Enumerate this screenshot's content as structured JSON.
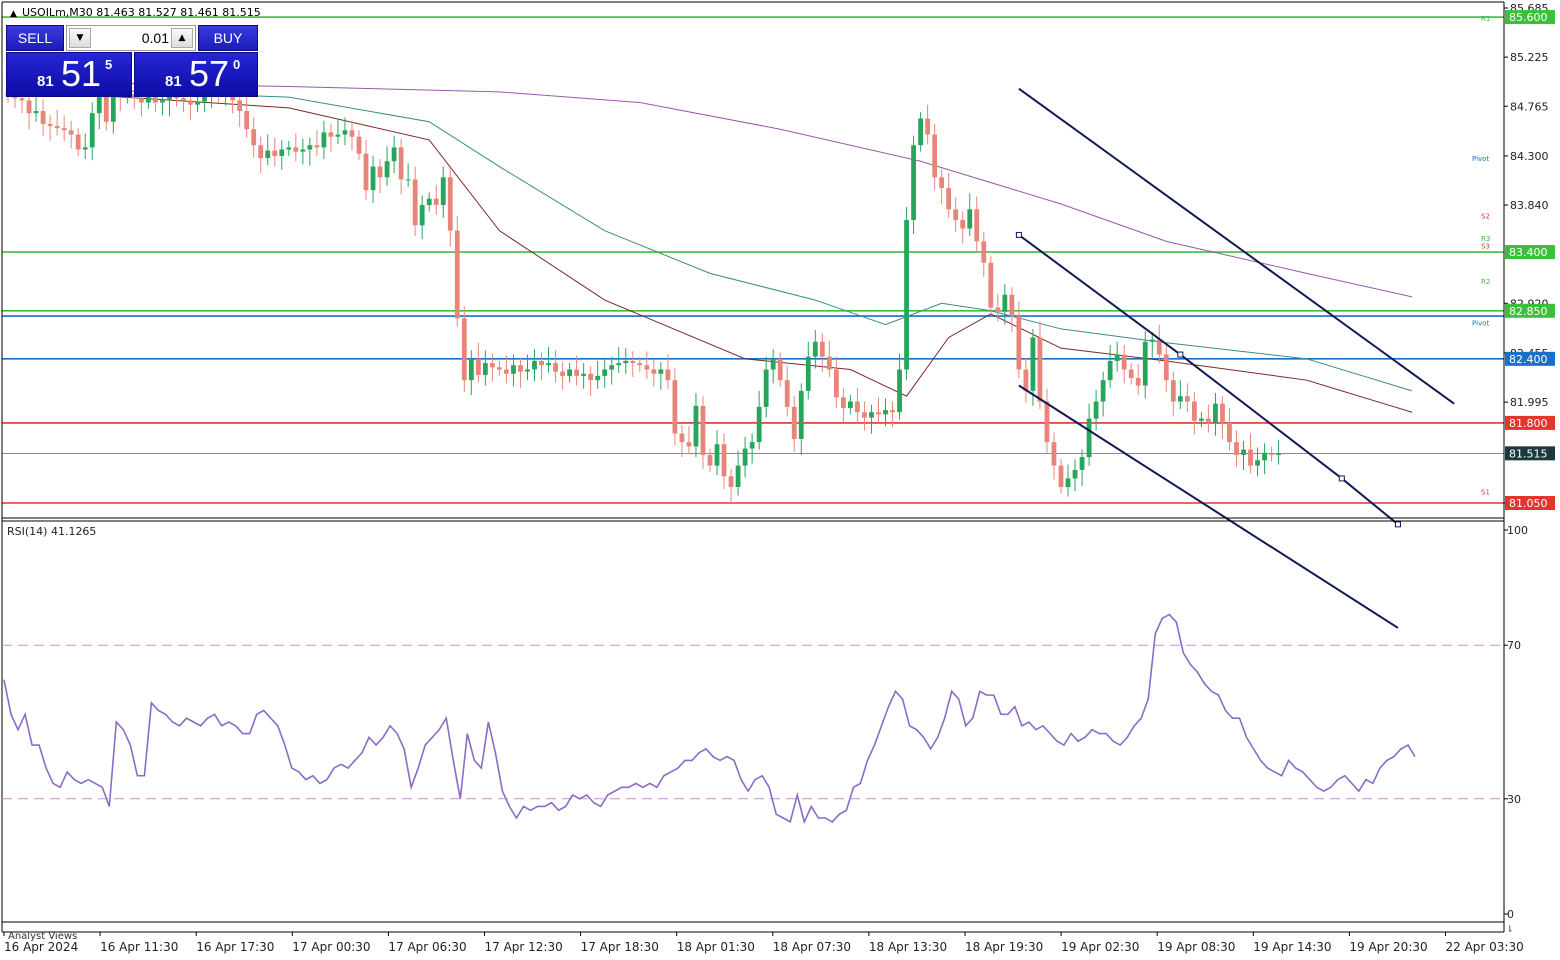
{
  "symbol_header": "USOILm,M30  81.463 81.527 81.461 81.515",
  "trade_panel": {
    "sell_label": "SELL",
    "buy_label": "BUY",
    "lot": "0.01",
    "bid": {
      "small": "81",
      "big": "51",
      "sup": "5"
    },
    "ask": {
      "small": "81",
      "big": "57",
      "sup": "0"
    }
  },
  "colors": {
    "bull": "#26a65b",
    "bear": "#e8857a",
    "ma_fast": "#7a2a2a",
    "ma_mid": "#3c8a8a",
    "ma_slow": "#9b59a8",
    "rsi": "#8a6cc7",
    "level_green": "#3cc03c",
    "level_blue": "#1a6fc6",
    "level_red": "#e0362c",
    "channel": "#111a55",
    "price_line": "#1a3a40"
  },
  "chart_data": [
    {
      "type": "candlestick",
      "title": "USOILm,M30",
      "ylim": [
        81.05,
        85.685
      ],
      "y_ticks": [
        "85.685",
        "85.225",
        "84.765",
        "84.300",
        "83.840",
        "82.920",
        "82.455",
        "81.995",
        "81.050"
      ],
      "x_ticks": [
        "16 Apr 2024",
        "16 Apr 11:30",
        "16 Apr 17:30",
        "17 Apr 00:30",
        "17 Apr 06:30",
        "17 Apr 12:30",
        "17 Apr 18:30",
        "18 Apr 01:30",
        "18 Apr 07:30",
        "18 Apr 13:30",
        "18 Apr 19:30",
        "19 Apr 02:30",
        "19 Apr 08:30",
        "19 Apr 14:30",
        "19 Apr 20:30",
        "22 Apr 03:30"
      ],
      "levels": [
        {
          "value": 85.6,
          "label": "85.600",
          "color": "level_green"
        },
        {
          "value": 83.4,
          "label": "83.400",
          "color": "level_green"
        },
        {
          "value": 82.85,
          "label": "82.850",
          "color": "level_green"
        },
        {
          "value": 82.8,
          "label": "",
          "color": "level_blue"
        },
        {
          "value": 82.4,
          "label": "82.400",
          "color": "level_blue"
        },
        {
          "value": 81.8,
          "label": "81.800",
          "color": "level_red"
        },
        {
          "value": 81.05,
          "label": "81.050",
          "color": "level_red"
        }
      ],
      "current_price": "81.515",
      "pivot_marks": [
        {
          "text": "R1",
          "value": 85.59,
          "color": "#3cc03c"
        },
        {
          "text": "Pivot",
          "value": 84.28,
          "color": "#1a6fc6"
        },
        {
          "text": "S2",
          "value": 83.74,
          "color": "#e0362c"
        },
        {
          "text": "R3",
          "value": 83.53,
          "color": "#3cc03c"
        },
        {
          "text": "S3",
          "value": 83.46,
          "color": "#e0362c"
        },
        {
          "text": "R2",
          "value": 83.13,
          "color": "#3cc03c"
        },
        {
          "text": "Pivot",
          "value": 82.74,
          "color": "#1a6fc6"
        },
        {
          "text": "S1",
          "value": 81.16,
          "color": "#e0362c"
        }
      ],
      "closes": [
        84.86,
        84.84,
        84.82,
        84.7,
        84.72,
        84.6,
        84.58,
        84.56,
        84.54,
        84.5,
        84.36,
        84.38,
        84.7,
        84.9,
        84.62,
        84.99,
        84.86,
        84.88,
        84.84,
        84.8,
        84.86,
        84.8,
        84.82,
        84.86,
        84.84,
        84.82,
        84.78,
        84.81,
        84.88,
        84.9,
        84.86,
        84.88,
        84.82,
        84.72,
        84.55,
        84.4,
        84.28,
        84.35,
        84.3,
        84.36,
        84.38,
        84.34,
        84.36,
        84.4,
        84.38,
        84.52,
        84.48,
        84.5,
        84.54,
        84.48,
        84.32,
        83.98,
        84.2,
        84.1,
        84.25,
        84.38,
        84.08,
        84.08,
        83.65,
        83.84,
        83.9,
        83.84,
        84.1,
        83.6,
        82.78,
        82.2,
        82.4,
        82.25,
        82.36,
        82.32,
        82.3,
        82.26,
        82.34,
        82.28,
        82.3,
        82.38,
        82.34,
        82.36,
        82.28,
        82.24,
        82.3,
        82.24,
        82.26,
        82.2,
        82.24,
        82.3,
        82.34,
        82.36,
        82.38,
        82.36,
        82.34,
        82.3,
        82.26,
        82.3,
        82.2,
        81.7,
        81.62,
        81.58,
        81.96,
        81.5,
        81.4,
        81.6,
        81.3,
        81.2,
        81.4,
        81.56,
        81.62,
        81.95,
        82.3,
        82.4,
        82.2,
        81.95,
        81.65,
        82.1,
        82.42,
        82.56,
        82.42,
        82.3,
        82.04,
        81.94,
        82.0,
        81.9,
        81.85,
        81.9,
        81.88,
        81.92,
        81.9,
        82.3,
        83.7,
        84.4,
        84.65,
        84.5,
        84.1,
        84.0,
        83.8,
        83.7,
        83.62,
        83.8,
        83.5,
        83.3,
        82.88,
        82.84,
        83.0,
        82.8,
        82.3,
        82.1,
        82.6,
        82.0,
        81.62,
        81.4,
        81.2,
        81.28,
        81.36,
        81.48,
        81.84,
        82.0,
        82.2,
        82.38,
        82.44,
        82.3,
        82.22,
        82.15,
        82.56,
        82.58,
        82.44,
        82.2,
        82.0,
        82.05,
        82.0,
        81.82,
        81.84,
        81.8,
        81.98,
        81.8,
        81.62,
        81.5,
        81.55,
        81.4,
        81.45,
        81.52,
        81.5,
        81.51
      ],
      "ma_slow": [
        [
          0,
          85.0
        ],
        [
          40,
          84.95
        ],
        [
          70,
          84.9
        ],
        [
          90,
          84.8
        ],
        [
          110,
          84.55
        ],
        [
          130,
          84.25
        ],
        [
          150,
          83.85
        ],
        [
          165,
          83.5
        ],
        [
          185,
          83.2
        ],
        [
          200,
          82.98
        ]
      ],
      "ma_mid": [
        [
          0,
          84.95
        ],
        [
          40,
          84.85
        ],
        [
          60,
          84.62
        ],
        [
          70,
          84.2
        ],
        [
          85,
          83.6
        ],
        [
          100,
          83.2
        ],
        [
          115,
          82.95
        ],
        [
          125,
          82.72
        ],
        [
          133,
          82.92
        ],
        [
          140,
          82.85
        ],
        [
          150,
          82.68
        ],
        [
          165,
          82.55
        ],
        [
          185,
          82.4
        ],
        [
          200,
          82.1
        ]
      ],
      "ma_fast": [
        [
          0,
          84.92
        ],
        [
          40,
          84.75
        ],
        [
          60,
          84.45
        ],
        [
          70,
          83.6
        ],
        [
          85,
          82.95
        ],
        [
          105,
          82.4
        ],
        [
          120,
          82.3
        ],
        [
          128,
          82.05
        ],
        [
          134,
          82.6
        ],
        [
          140,
          82.82
        ],
        [
          150,
          82.5
        ],
        [
          165,
          82.38
        ],
        [
          185,
          82.2
        ],
        [
          200,
          81.9
        ]
      ],
      "channel_lines": [
        [
          [
            144,
            84.93
          ],
          [
            206,
            81.98
          ]
        ],
        [
          [
            144,
            82.15
          ],
          [
            198,
            79.88
          ]
        ],
        [
          [
            144,
            83.56
          ],
          [
            167,
            82.44
          ],
          [
            190,
            81.28
          ],
          [
            198,
            80.85
          ]
        ]
      ]
    },
    {
      "type": "line",
      "title": "RSI(14) 41.1265",
      "ylim": [
        0,
        100
      ],
      "y_ticks": [
        "100",
        "70",
        "30",
        "0"
      ],
      "guides": [
        70,
        30
      ],
      "values": [
        61,
        52,
        48,
        52,
        44,
        44,
        38,
        34,
        33,
        37,
        35,
        34,
        35,
        34,
        33,
        28,
        50,
        48,
        44,
        36,
        36,
        55,
        53,
        52,
        50,
        49,
        51,
        50,
        49,
        51,
        52,
        49,
        50,
        49,
        47,
        47,
        52,
        53,
        51,
        49,
        44,
        38,
        37,
        35,
        36,
        34,
        35,
        38,
        39,
        38,
        40,
        42,
        46,
        44,
        46,
        49,
        47,
        43,
        33,
        38,
        44,
        46,
        48,
        51,
        40,
        30,
        47,
        40,
        38,
        50,
        42,
        32,
        28,
        25,
        28,
        27,
        28,
        28,
        29,
        27,
        28,
        31,
        30,
        31,
        29,
        28,
        31,
        32,
        33,
        33,
        34,
        33,
        34,
        33,
        36,
        37,
        38,
        40,
        40,
        42,
        43,
        41,
        40,
        41,
        40,
        35,
        32,
        35,
        36,
        33,
        26,
        25,
        24,
        31,
        24,
        28,
        25,
        25,
        24,
        26,
        27,
        33,
        34,
        40,
        44,
        49,
        54,
        58,
        56,
        49,
        48,
        46,
        43,
        46,
        51,
        58,
        56,
        49,
        51,
        58,
        57,
        57,
        52,
        52,
        54,
        49,
        50,
        48,
        49,
        47,
        45,
        44,
        47,
        45,
        46,
        48,
        47,
        47,
        45,
        44,
        46,
        49,
        51,
        56,
        73,
        77,
        78,
        76,
        68,
        65,
        63,
        60,
        58,
        57,
        53,
        51,
        51,
        46,
        43,
        40,
        38,
        37,
        36,
        40,
        38,
        37,
        35,
        33,
        32,
        33,
        35,
        36,
        34,
        32,
        35,
        34,
        38,
        40,
        41,
        43,
        44,
        41
      ]
    }
  ]
}
